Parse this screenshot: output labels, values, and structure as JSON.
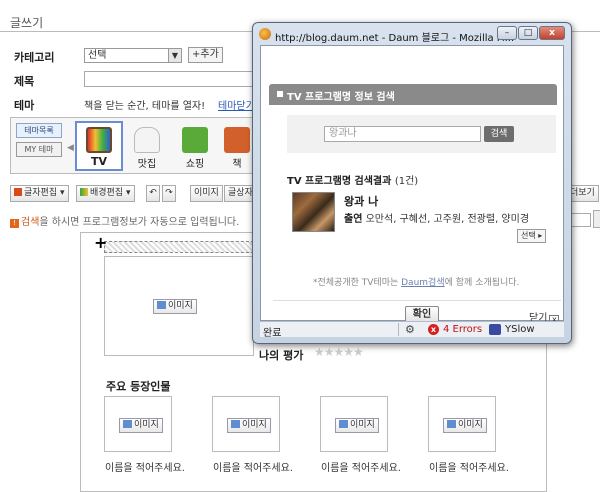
{
  "page": {
    "title": "글쓰기",
    "labels": {
      "category": "카테고리",
      "subject": "제목",
      "theme": "테마"
    },
    "category_value": "선택",
    "add_button": "+추가",
    "theme_prompt": "책을 닫는 순간, 테마를 열자!",
    "theme_close_link": "테마닫기",
    "theme_tabs": [
      "테마목록",
      "MY 테마"
    ],
    "theme_tiles": [
      {
        "label": "TV",
        "icon": "tv-icon",
        "color": "#8a6a3a"
      },
      {
        "label": "맛집",
        "icon": "chef-hat-icon",
        "color": "#e4e4e4"
      },
      {
        "label": "쇼핑",
        "icon": "shopping-bag-icon",
        "color": "#5aaa3a"
      },
      {
        "label": "책",
        "icon": "book-icon",
        "color": "#d2602a"
      }
    ],
    "toolbar": [
      "글자편집",
      "배경편집",
      "이미지",
      "글상자"
    ],
    "toolbar_right": "더보기",
    "notice": {
      "em": "검색",
      "rest": "을 하시면 프로그램정보가 자동으로 입력됩니다."
    },
    "image_button": "이미지",
    "rating_label": "나의 평가",
    "rating_stars": "★★★★★",
    "cast_title": "주요 등장인물",
    "cast_placeholder": "이름을 적어주세요."
  },
  "popup": {
    "window_title": "http://blog.daum.net - Daum 블로그 - Mozilla Fi...",
    "header": "TV 프로그램명 정보 검색",
    "search_value": "왕과나",
    "search_button": "검색",
    "result_heading": "TV 프로그램명 검색결과",
    "result_count": "(1건)",
    "show_title": "왕과 나",
    "cast_label": "출연",
    "cast_list": "오만석, 구혜선, 고주원, 전광렬, 양미경",
    "select_button": "선택 ▸",
    "footnote_prefix": "*전체공개한 TV테마는 ",
    "footnote_link": "Daum검색",
    "footnote_suffix": "에 함께 소개됩니다.",
    "confirm_button": "확인",
    "close_label": "닫기",
    "close_x": "x",
    "status": {
      "done": "완료",
      "errors": "4 Errors",
      "yslow": "YSlow"
    }
  }
}
